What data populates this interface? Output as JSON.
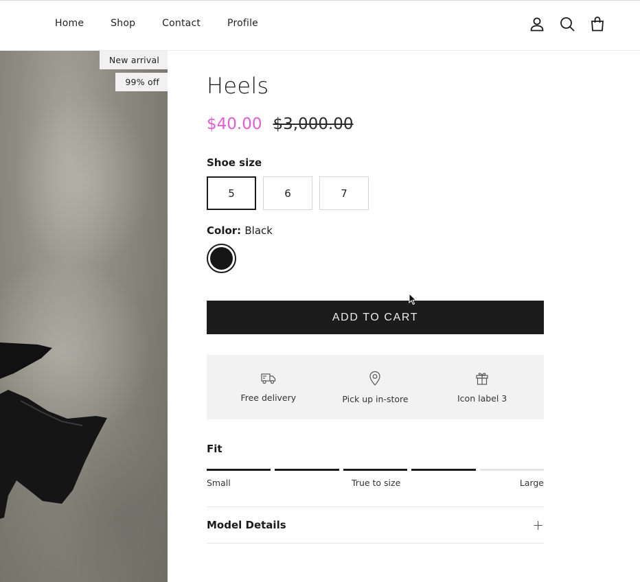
{
  "nav": {
    "links": [
      "Home",
      "Shop",
      "Contact",
      "Profile"
    ]
  },
  "header_icons": [
    "account-icon",
    "search-icon",
    "cart-icon"
  ],
  "hero": {
    "badges": [
      "New arrival",
      "99% off"
    ]
  },
  "product": {
    "title": "Heels",
    "price_sale": "$40.00",
    "price_original": "$3,000.00",
    "sale_color": "#e35cd5"
  },
  "size": {
    "label": "Shoe size",
    "options": [
      "5",
      "6",
      "7"
    ],
    "selected": "5"
  },
  "color": {
    "label": "Color:",
    "value": "Black",
    "swatch": "#161616"
  },
  "cart": {
    "button_label": "ADD TO CART"
  },
  "features": [
    {
      "icon": "delivery-truck-icon",
      "label": "Free delivery"
    },
    {
      "icon": "map-pin-icon",
      "label": "Pick up in-store"
    },
    {
      "icon": "gift-icon",
      "label": "Icon label 3"
    }
  ],
  "fit": {
    "title": "Fit",
    "segments_filled": 4,
    "segments_total": 5,
    "labels": {
      "left": "Small",
      "middle": "True to size",
      "right": "Large"
    }
  },
  "accordion": {
    "title": "Model Details",
    "toggle": "+"
  }
}
